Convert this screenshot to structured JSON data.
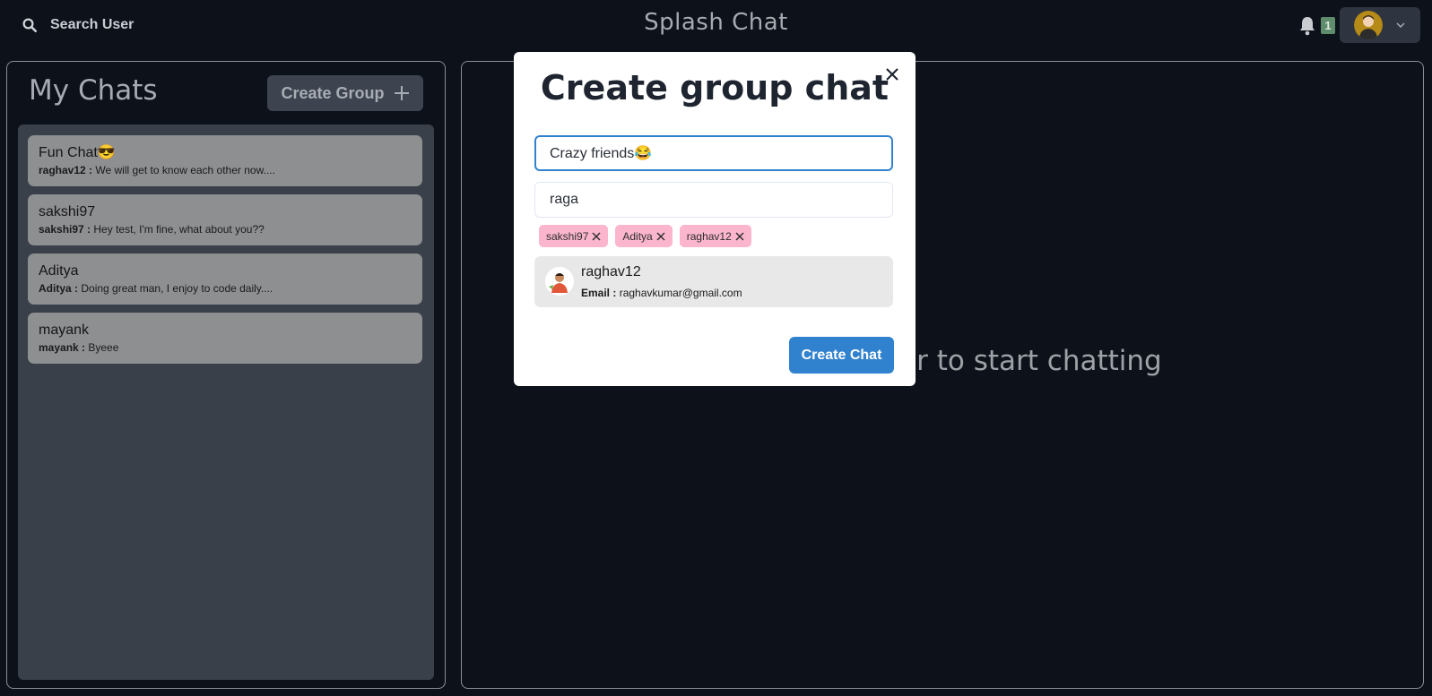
{
  "header": {
    "search_label": "Search User",
    "app_title": "Splash Chat",
    "notification_count": "1"
  },
  "sidebar": {
    "title": "My Chats",
    "create_group_label": "Create Group",
    "chats": [
      {
        "name": "Fun Chat😎",
        "sender": "raghav12 :",
        "message": "We will get to know each other now...."
      },
      {
        "name": "sakshi97",
        "sender": "sakshi97 :",
        "message": "Hey test, I'm fine, what about you??"
      },
      {
        "name": "Aditya",
        "sender": "Aditya :",
        "message": "Doing great man, I enjoy to code daily...."
      },
      {
        "name": "mayank",
        "sender": "mayank :",
        "message": "Byeee"
      }
    ]
  },
  "main": {
    "placeholder": "Click on a user to start chatting"
  },
  "modal": {
    "title": "Create group chat",
    "chat_name_value": "Crazy friends😂",
    "search_value": "raga",
    "selected_users": [
      "sakshi97",
      "Aditya",
      "raghav12"
    ],
    "result": {
      "name": "raghav12",
      "email_label": "Email :",
      "email": "raghavkumar@gmail.com"
    },
    "create_button_label": "Create Chat"
  },
  "colors": {
    "accent": "#3182ce",
    "chip": "#fbb6ce",
    "background": "#0c111a"
  }
}
